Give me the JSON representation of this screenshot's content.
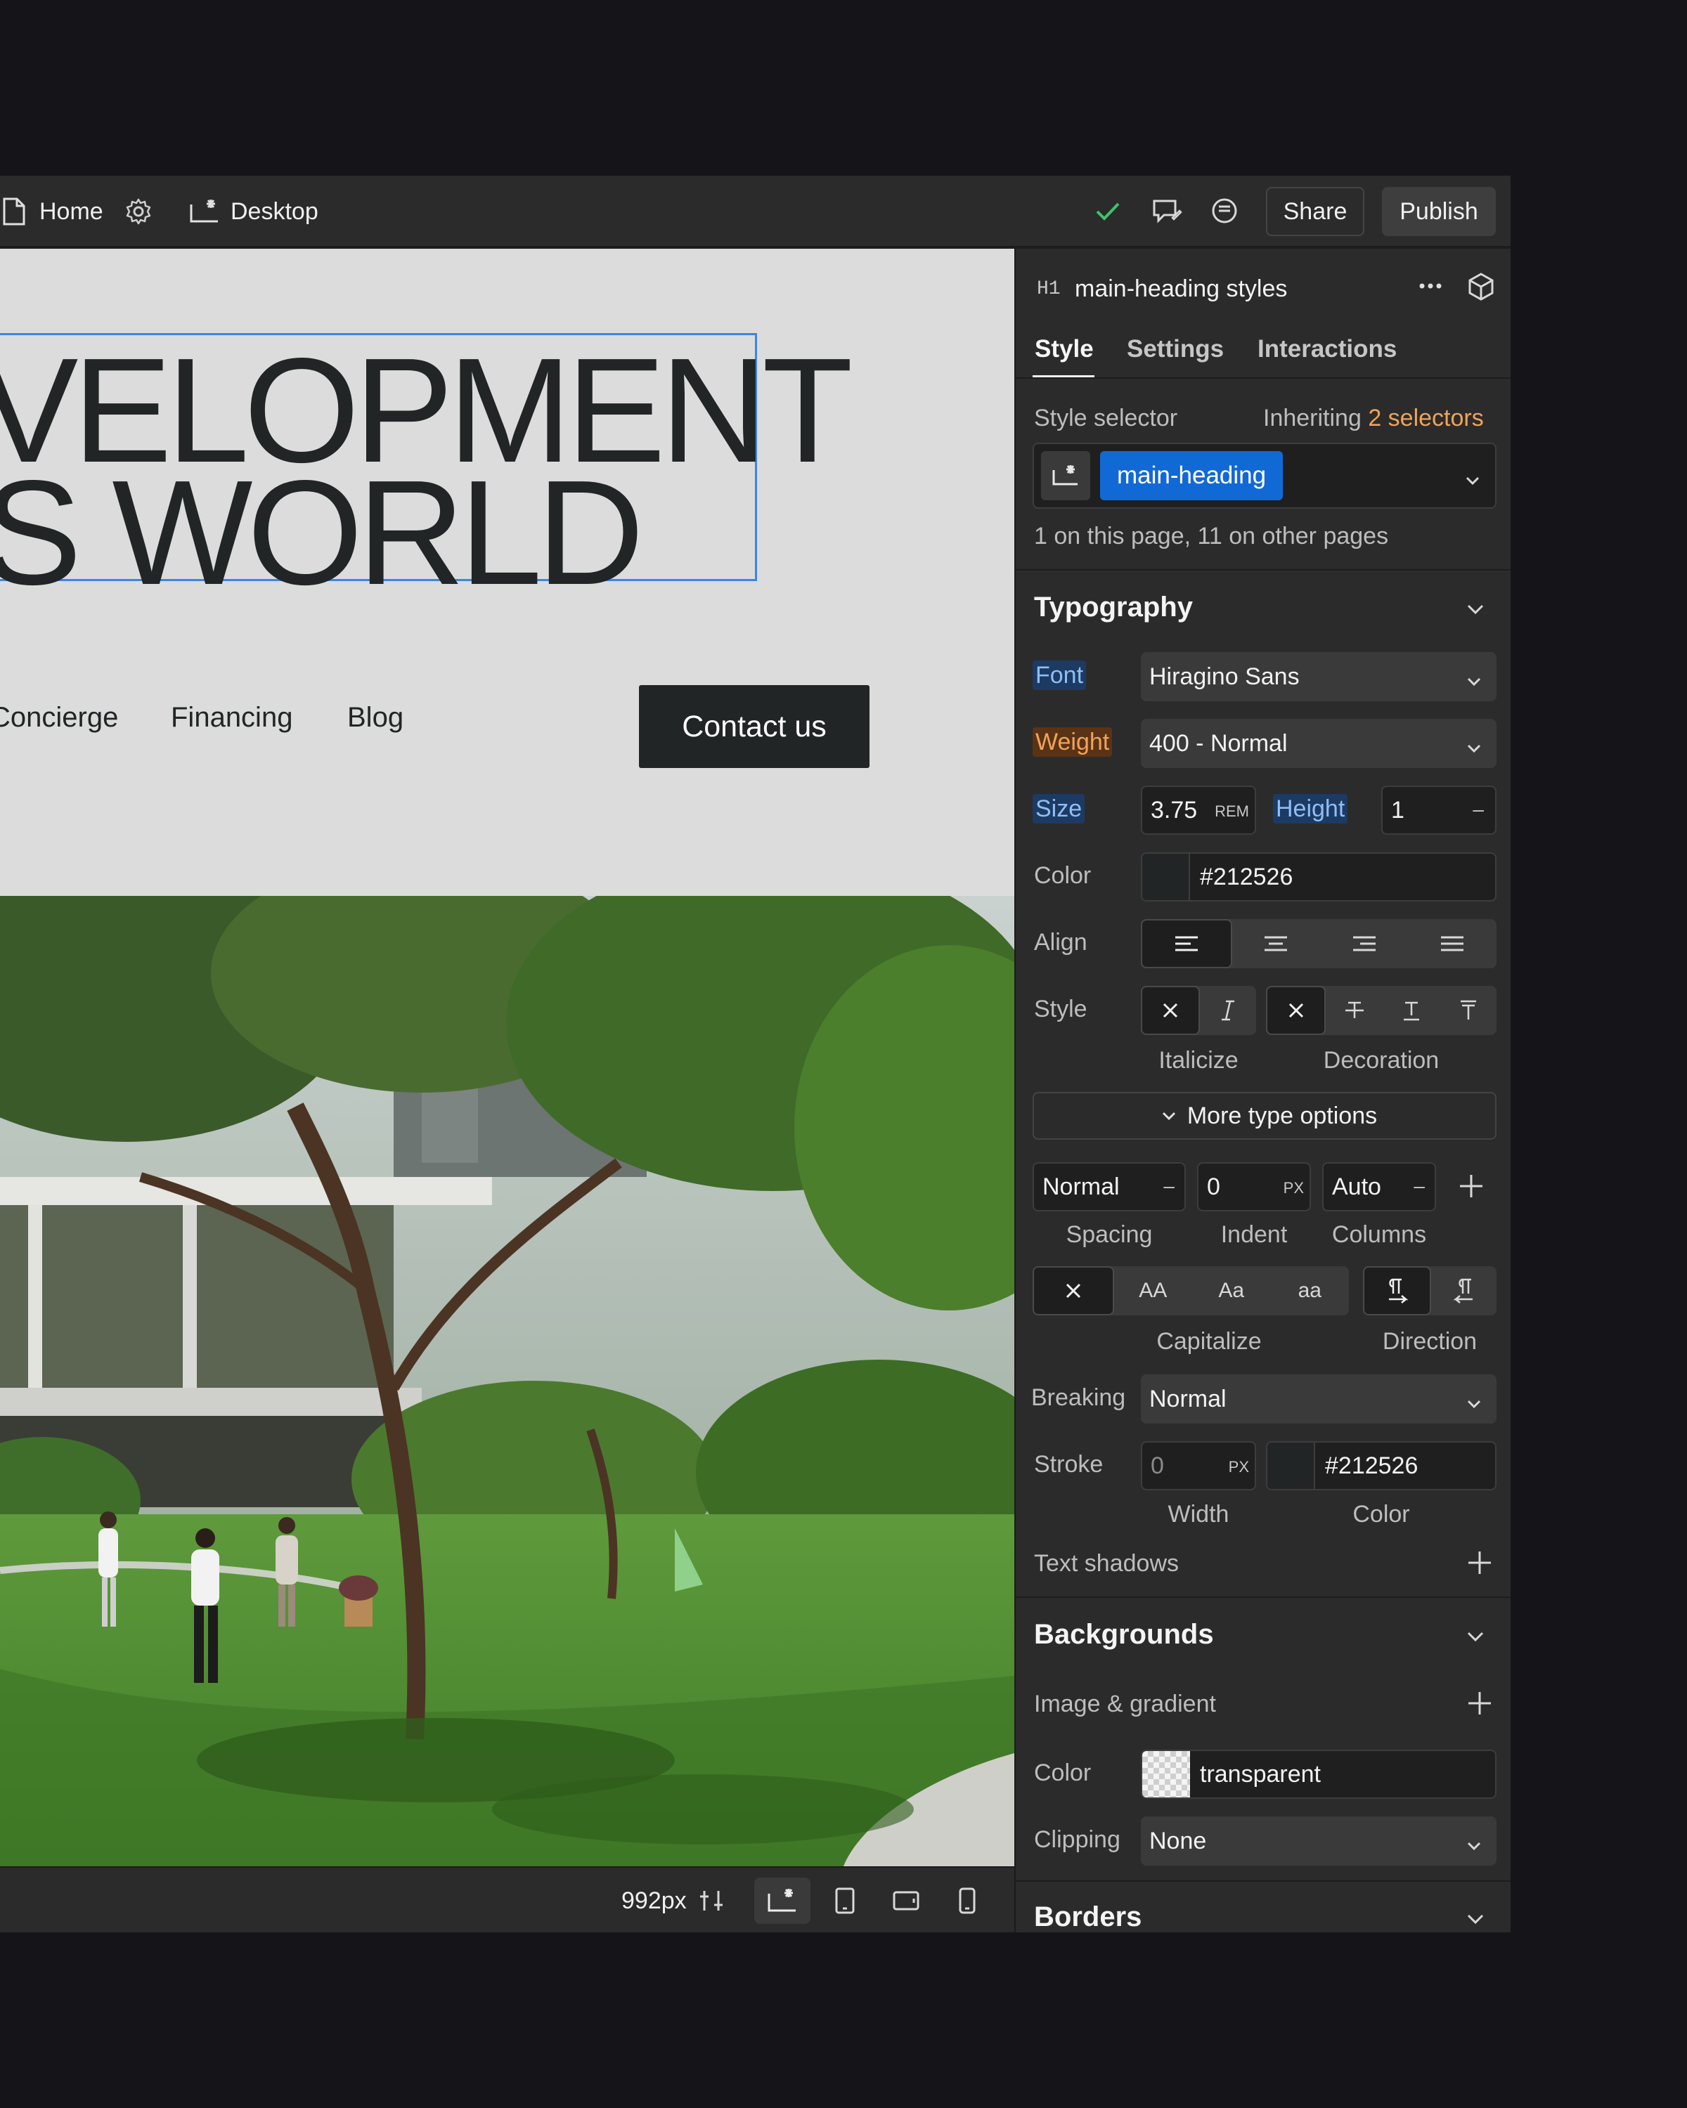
{
  "topbar": {
    "page_name": "Home",
    "breakpoint": "Desktop",
    "share_label": "Share",
    "publish_label": "Publish"
  },
  "canvas": {
    "heading_line1": "VELOPMENT",
    "heading_line2": "’S WORLD",
    "nav": [
      "Concierge",
      "Financing",
      "Blog"
    ],
    "contact_label": "Contact us"
  },
  "bottombar": {
    "width_readout": "992px"
  },
  "panel": {
    "element_tag": "H1",
    "element_title": "main-heading styles",
    "tabs": [
      "Style",
      "Settings",
      "Interactions"
    ],
    "style_selector_label": "Style selector",
    "inheriting_prefix": "Inheriting",
    "inheriting_link": "2 selectors",
    "selector_chip": "main-heading",
    "usage_note": "1 on this page, 11 on other pages",
    "typography": {
      "title": "Typography",
      "font_label": "Font",
      "font_value": "Hiragino Sans",
      "weight_label": "Weight",
      "weight_value": "400 - Normal",
      "size_label": "Size",
      "size_value": "3.75",
      "size_unit": "REM",
      "height_label": "Height",
      "height_value": "1",
      "color_label": "Color",
      "color_value": "#212526",
      "align_label": "Align",
      "style_label": "Style",
      "italicize_label": "Italicize",
      "decoration_label": "Decoration",
      "more_label": "More type options",
      "spacing_value": "Normal",
      "indent_value": "0",
      "indent_unit": "PX",
      "columns_value": "Auto",
      "spacing_label": "Spacing",
      "indent_label": "Indent",
      "columns_label": "Columns",
      "cap_options": [
        "AA",
        "Aa",
        "aa"
      ],
      "capitalize_label": "Capitalize",
      "direction_label": "Direction",
      "breaking_label": "Breaking",
      "breaking_value": "Normal",
      "stroke_label": "Stroke",
      "stroke_width": "0",
      "stroke_unit": "PX",
      "stroke_color": "#212526",
      "width_label": "Width",
      "stroke_color_label": "Color",
      "text_shadows_label": "Text shadows"
    },
    "backgrounds": {
      "title": "Backgrounds",
      "image_gradient_label": "Image & gradient",
      "color_label": "Color",
      "color_value": "transparent",
      "clipping_label": "Clipping",
      "clipping_value": "None"
    },
    "borders": {
      "title": "Borders"
    }
  },
  "colors": {
    "accent_blue": "#1169d6",
    "inherit_orange": "#f0a35a",
    "text_color_swatch": "#212526"
  }
}
